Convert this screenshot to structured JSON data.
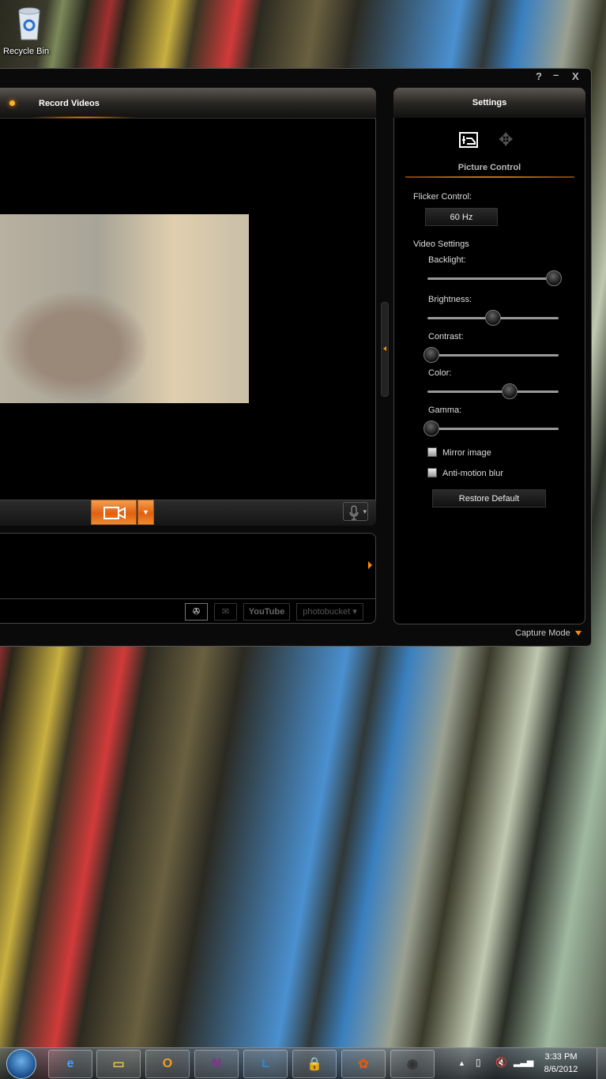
{
  "desktop": {
    "recycle_bin": "Recycle Bin"
  },
  "window": {
    "help": "?",
    "minimize": "–",
    "close": "X",
    "footer_mode": "Capture Mode"
  },
  "main": {
    "tab_label": "Record Videos",
    "share": {
      "youtube": "YouTube",
      "photobucket": "photobucket"
    }
  },
  "settings": {
    "title": "Settings",
    "section": "Picture Control",
    "flicker_label": "Flicker Control:",
    "flicker_value": "60 Hz",
    "video_settings_label": "Video Settings",
    "sliders": [
      {
        "label": "Backlight:",
        "value": 1.0
      },
      {
        "label": "Brightness:",
        "value": 0.5
      },
      {
        "label": "Contrast:",
        "value": 0.0
      },
      {
        "label": "Color:",
        "value": 0.64
      },
      {
        "label": "Gamma:",
        "value": 0.0
      }
    ],
    "mirror_image": "Mirror image",
    "mirror_checked": false,
    "anti_motion_blur": "Anti-motion blur",
    "anti_motion_checked": false,
    "restore_default": "Restore Default"
  },
  "accent_color": "#ff8a00",
  "taskbar": {
    "apps": [
      "internet-explorer",
      "windows-explorer",
      "outlook",
      "onenote",
      "lync",
      "keepass",
      "photo-gallery",
      "webcam"
    ],
    "time": "3:33 PM",
    "date": "8/6/2012"
  }
}
